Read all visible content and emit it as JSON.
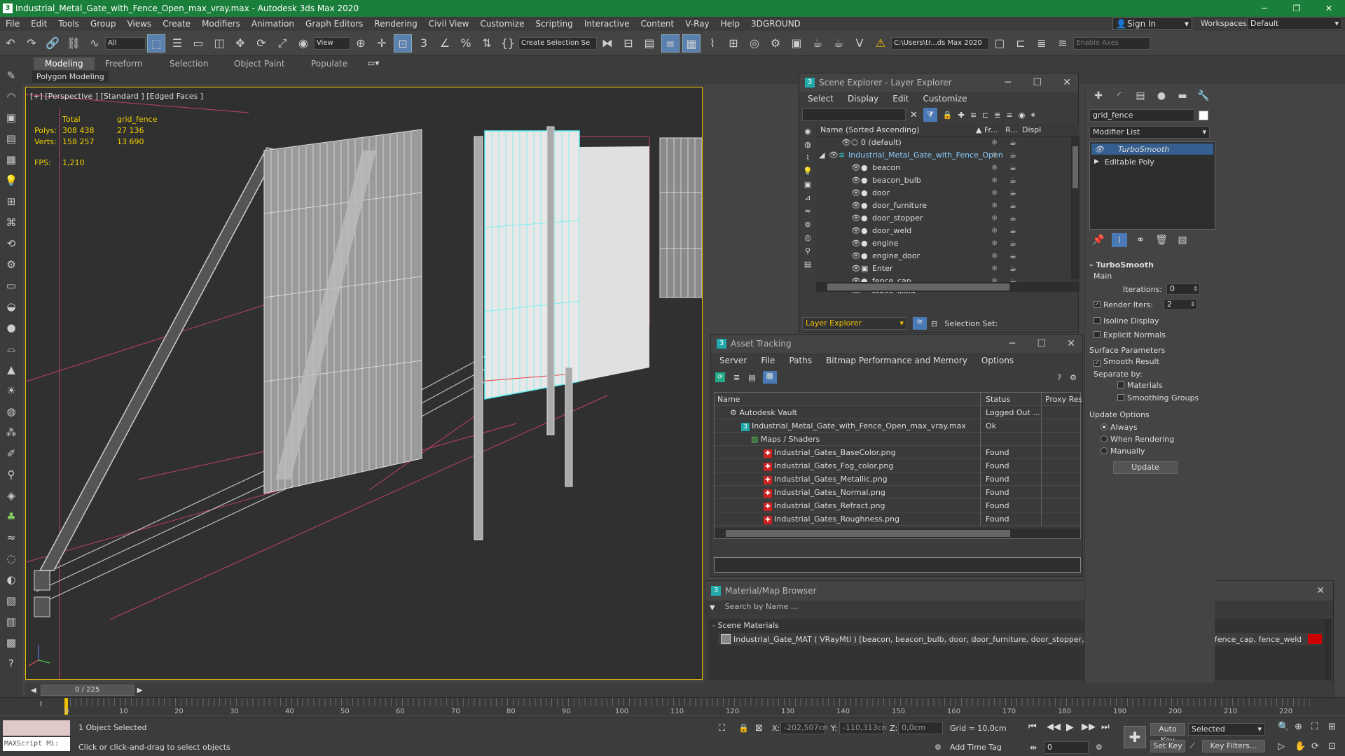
{
  "window": {
    "title": "Industrial_Metal_Gate_with_Fence_Open_max_vray.max - Autodesk 3ds Max 2020",
    "controls": [
      "─",
      "❐",
      "✕"
    ]
  },
  "menubar": {
    "items": [
      "File",
      "Edit",
      "Tools",
      "Group",
      "Views",
      "Create",
      "Modifiers",
      "Animation",
      "Graph Editors",
      "Rendering",
      "Civil View",
      "Customize",
      "Scripting",
      "Interactive",
      "Content",
      "V-Ray",
      "Help",
      "3DGROUND"
    ],
    "sign_in": "Sign In",
    "workspaces_label": "Workspaces:",
    "workspace_value": "Default"
  },
  "toolbar": {
    "selection_filter": "All",
    "view_select": "View",
    "named_selection": "Create Selection Se",
    "project_path": "C:\\Users\\tr...ds Max 2020",
    "enable_axes": "Enable Axes"
  },
  "ribbon": {
    "tabs": [
      "Modeling",
      "Freeform",
      "Selection",
      "Object Paint",
      "Populate"
    ],
    "active_tab": "Modeling",
    "panel_label": "Polygon Modeling"
  },
  "viewport": {
    "label": "[+] [Perspective ] [Standard ] [Edged Faces ]",
    "stats": {
      "total_header": "Total",
      "object_header": "grid_fence",
      "polys_label": "Polys:",
      "polys_total": "308 438",
      "polys_obj": "27 136",
      "verts_label": "Verts:",
      "verts_total": "158 257",
      "verts_obj": "13 690",
      "fps_label": "FPS:",
      "fps_value": "1,210"
    }
  },
  "scene_explorer": {
    "title": "Scene Explorer - Layer Explorer",
    "menu": [
      "Select",
      "Display",
      "Edit",
      "Customize"
    ],
    "columns": [
      "Name (Sorted Ascending)",
      "Fr...",
      "R...",
      "Displ"
    ],
    "rows": [
      "0 (default)",
      "Industrial_Metal_Gate_with_Fence_Open",
      "beacon",
      "beacon_bulb",
      "door",
      "door_furniture",
      "door_stopper",
      "door_weld",
      "engine",
      "engine_door",
      "Enter",
      "fence_cap",
      "fence_weld"
    ],
    "footer_layer": "Layer Explorer",
    "selection_set_label": "Selection Set:"
  },
  "asset_tracking": {
    "title": "Asset Tracking",
    "menu": [
      "Server",
      "File",
      "Paths",
      "Bitmap Performance and Memory",
      "Options"
    ],
    "columns": [
      "Name",
      "Status",
      "Proxy Reso"
    ],
    "rows": [
      {
        "name": "Autodesk Vault",
        "status": "Logged Out ..."
      },
      {
        "name": "Industrial_Metal_Gate_with_Fence_Open_max_vray.max",
        "status": "Ok"
      },
      {
        "name": "Maps / Shaders",
        "status": ""
      },
      {
        "name": "Industrial_Gates_BaseColor.png",
        "status": "Found"
      },
      {
        "name": "Industrial_Gates_Fog_color.png",
        "status": "Found"
      },
      {
        "name": "Industrial_Gates_Metallic.png",
        "status": "Found"
      },
      {
        "name": "Industrial_Gates_Normal.png",
        "status": "Found"
      },
      {
        "name": "Industrial_Gates_Refract.png",
        "status": "Found"
      },
      {
        "name": "Industrial_Gates_Roughness.png",
        "status": "Found"
      }
    ]
  },
  "material_browser": {
    "title": "Material/Map Browser",
    "search_placeholder": "Search by Name ...",
    "section": "- Scene Materials",
    "material": "Industrial_Gate_MAT ( VRayMtl ) [beacon, beacon_bulb, door, door_furniture, door_stopper, door_weld, engine, engine_door, fence_cap, fence_weld, gate,..."
  },
  "command_panel": {
    "object_name": "grid_fence",
    "modifier_list": "Modifier List",
    "stack": [
      "TurboSmooth",
      "Editable Poly"
    ],
    "turbosmooth": {
      "header": "TurboSmooth",
      "main": "Main",
      "iterations_label": "Iterations:",
      "iterations": "0",
      "render_iters_label": "Render Iters:",
      "render_iters": "2",
      "isoline": "Isoline Display",
      "explicit_normals": "Explicit Normals",
      "surface_params": "Surface Parameters",
      "smooth_result": "Smooth Result",
      "separate_by": "Separate by:",
      "materials": "Materials",
      "smoothing_groups": "Smoothing Groups",
      "update_options": "Update Options",
      "always": "Always",
      "when_rendering": "When Rendering",
      "manually": "Manually",
      "update_button": "Update"
    }
  },
  "timeline": {
    "frame": "0 / 225",
    "ticks": [
      "0",
      "10",
      "20",
      "30",
      "40",
      "50",
      "60",
      "70",
      "80",
      "90",
      "100",
      "110",
      "120",
      "130",
      "140",
      "150",
      "160",
      "170",
      "180",
      "190",
      "200",
      "210",
      "220"
    ]
  },
  "status": {
    "maxscript": "MAXScript Mi:",
    "selected": "1 Object Selected",
    "prompt": "Click or click-and-drag to select objects",
    "x_label": "X:",
    "x": "-202,507cn",
    "y_label": "Y:",
    "y": "-110,313cn",
    "z_label": "Z:",
    "z": "0,0cm",
    "grid": "Grid = 10,0cm",
    "add_time_tag": "Add Time Tag",
    "auto_key": "Auto Key",
    "set_key": "Set Key",
    "selected_dropdown": "Selected",
    "key_filters": "Key Filters...",
    "frame_field": "0"
  }
}
